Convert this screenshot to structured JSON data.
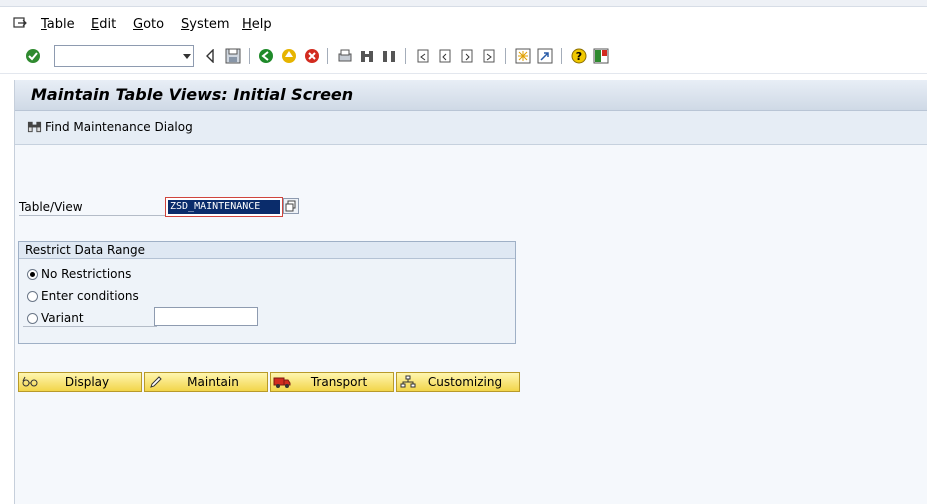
{
  "menubar": {
    "items": [
      {
        "label": "Table",
        "u": "T",
        "rest": "able"
      },
      {
        "label": "Edit",
        "u": "E",
        "rest": "dit"
      },
      {
        "label": "Goto",
        "u": "G",
        "rest": "oto"
      },
      {
        "label": "System",
        "u": "S",
        "rest": "ystem"
      },
      {
        "label": "Help",
        "u": "H",
        "rest": "elp"
      }
    ]
  },
  "toolbar": {
    "command_value": ""
  },
  "screen": {
    "title": "Maintain Table Views: Initial Screen",
    "find_label": "Find Maintenance Dialog",
    "table_view_label": "Table/View",
    "table_view_value": "ZSD_MAINTENANCE"
  },
  "restrict": {
    "header": "Restrict Data Range",
    "options": [
      "No Restrictions",
      "Enter conditions",
      "Variant"
    ],
    "selected": "No Restrictions",
    "variant_value": ""
  },
  "buttons": {
    "display": "Display",
    "maintain": "Maintain",
    "transport": "Transport",
    "customizing": "Customizing"
  },
  "colors": {
    "accent": "#0a2c6b",
    "button_yellow": "#f2d54a",
    "field_error_border": "#d0453d"
  }
}
